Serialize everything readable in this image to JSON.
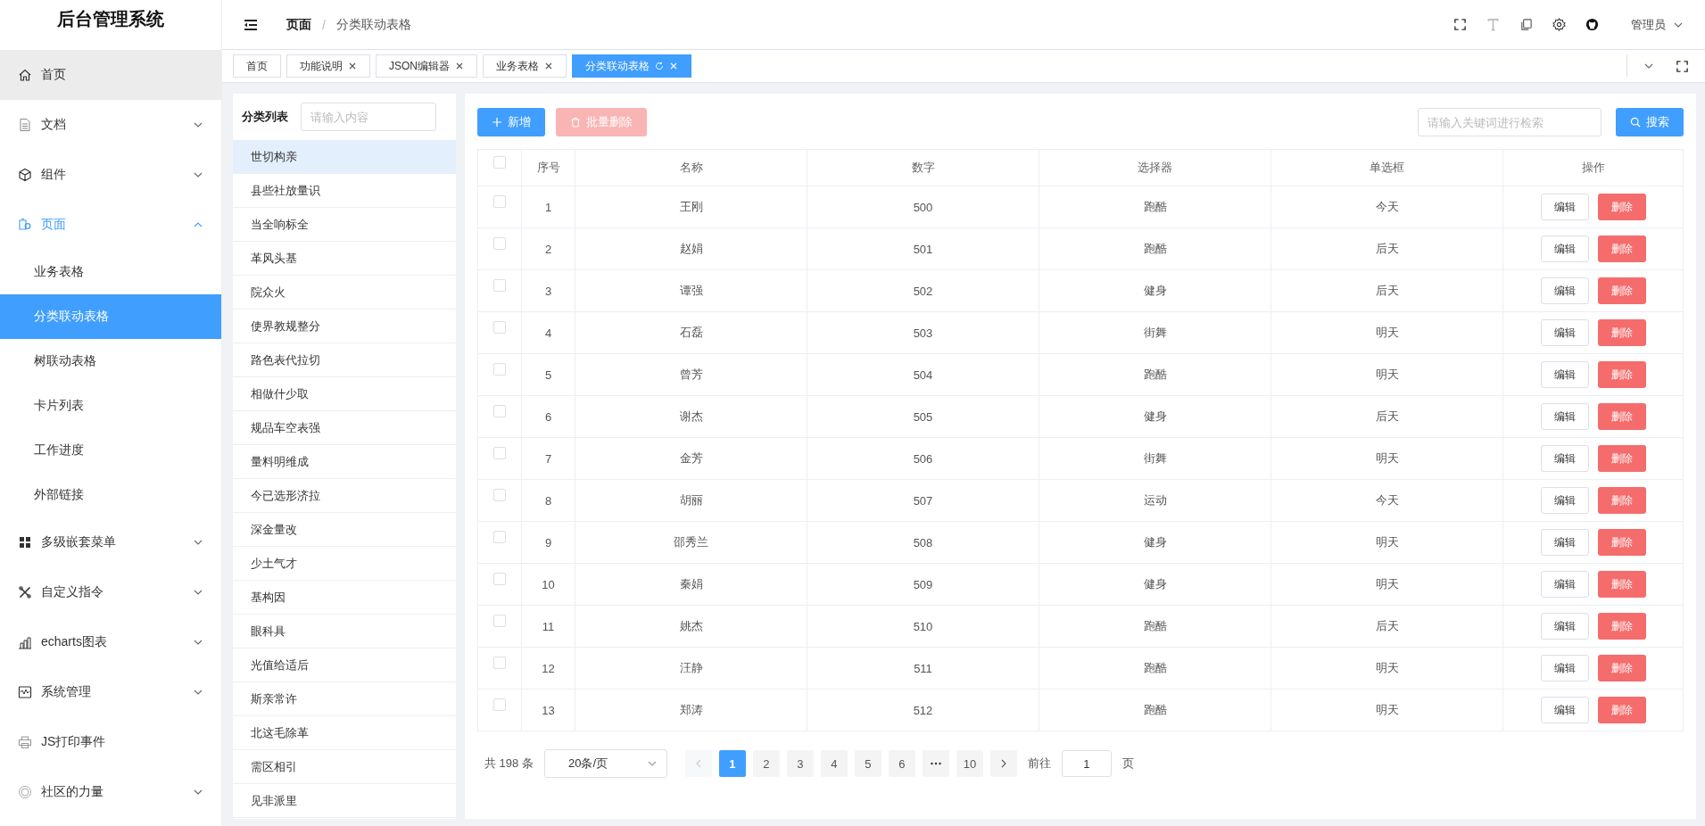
{
  "app_title": "后台管理系统",
  "sidebar": {
    "items": [
      {
        "label": "首页",
        "kind": "link",
        "hovered": true,
        "expanded": false
      },
      {
        "label": "文档",
        "kind": "group",
        "hovered": false,
        "expanded": false
      },
      {
        "label": "组件",
        "kind": "group",
        "hovered": false,
        "expanded": false
      },
      {
        "label": "页面",
        "kind": "group",
        "hovered": false,
        "expanded": true,
        "children": [
          {
            "label": "业务表格",
            "selected": false
          },
          {
            "label": "分类联动表格",
            "selected": true
          },
          {
            "label": "树联动表格",
            "selected": false
          },
          {
            "label": "卡片列表",
            "selected": false
          },
          {
            "label": "工作进度",
            "selected": false
          },
          {
            "label": "外部链接",
            "selected": false
          }
        ]
      },
      {
        "label": "多级嵌套菜单",
        "kind": "group",
        "hovered": false,
        "expanded": false
      },
      {
        "label": "自定义指令",
        "kind": "group",
        "hovered": false,
        "expanded": false
      },
      {
        "label": "echarts图表",
        "kind": "group",
        "hovered": false,
        "expanded": false
      },
      {
        "label": "系统管理",
        "kind": "group",
        "hovered": false,
        "expanded": false
      },
      {
        "label": "JS打印事件",
        "kind": "link",
        "hovered": false,
        "expanded": false
      },
      {
        "label": "社区的力量",
        "kind": "group",
        "hovered": false,
        "expanded": false
      }
    ]
  },
  "breadcrumb": {
    "items": [
      "页面",
      "分类联动表格"
    ],
    "separator": "/"
  },
  "user": {
    "name": "管理员"
  },
  "tabs": [
    {
      "label": "首页",
      "selected": false,
      "closable": false
    },
    {
      "label": "功能说明",
      "selected": false,
      "closable": true
    },
    {
      "label": "JSON编辑器",
      "selected": false,
      "closable": true
    },
    {
      "label": "业务表格",
      "selected": false,
      "closable": true
    },
    {
      "label": "分类联动表格",
      "selected": true,
      "closable": true
    }
  ],
  "category_panel": {
    "title": "分类列表",
    "search": {
      "placeholder": "请输入内容"
    },
    "items": [
      {
        "label": "世切构亲",
        "selected": true
      },
      {
        "label": "县些社放量识",
        "selected": false
      },
      {
        "label": "当全响标全",
        "selected": false
      },
      {
        "label": "革风头基",
        "selected": false
      },
      {
        "label": "院众火",
        "selected": false
      },
      {
        "label": "使界教规整分",
        "selected": false
      },
      {
        "label": "路色表代拉切",
        "selected": false
      },
      {
        "label": "相做什少取",
        "selected": false
      },
      {
        "label": "规品车空表强",
        "selected": false
      },
      {
        "label": "量料明维成",
        "selected": false
      },
      {
        "label": "今已选形济拉",
        "selected": false
      },
      {
        "label": "深金量改",
        "selected": false
      },
      {
        "label": "少土气才",
        "selected": false
      },
      {
        "label": "基构因",
        "selected": false
      },
      {
        "label": "眼科具",
        "selected": false
      },
      {
        "label": "光值给适后",
        "selected": false
      },
      {
        "label": "斯亲常许",
        "selected": false
      },
      {
        "label": "北这毛除革",
        "selected": false
      },
      {
        "label": "需区相引",
        "selected": false
      },
      {
        "label": "见非派里",
        "selected": false
      }
    ]
  },
  "toolbar": {
    "add_button": {
      "label": "新增",
      "disabled": false
    },
    "batch_delete_button": {
      "label": "批量删除",
      "disabled": true
    },
    "search": {
      "placeholder": "请输入关键词进行检索"
    },
    "search_button": {
      "label": "搜索"
    }
  },
  "table": {
    "select_all_checked": false,
    "columns": [
      "序号",
      "名称",
      "数字",
      "选择器",
      "单选框",
      "操作"
    ],
    "rows": [
      {
        "checked": false,
        "cells": [
          "1",
          "王刚",
          "500",
          "跑酷",
          "今天"
        ],
        "actions": [
          "编辑",
          "删除"
        ]
      },
      {
        "checked": false,
        "cells": [
          "2",
          "赵娟",
          "501",
          "跑酷",
          "后天"
        ],
        "actions": [
          "编辑",
          "删除"
        ]
      },
      {
        "checked": false,
        "cells": [
          "3",
          "谭强",
          "502",
          "健身",
          "后天"
        ],
        "actions": [
          "编辑",
          "删除"
        ]
      },
      {
        "checked": false,
        "cells": [
          "4",
          "石磊",
          "503",
          "街舞",
          "明天"
        ],
        "actions": [
          "编辑",
          "删除"
        ]
      },
      {
        "checked": false,
        "cells": [
          "5",
          "曾芳",
          "504",
          "跑酷",
          "明天"
        ],
        "actions": [
          "编辑",
          "删除"
        ]
      },
      {
        "checked": false,
        "cells": [
          "6",
          "谢杰",
          "505",
          "健身",
          "后天"
        ],
        "actions": [
          "编辑",
          "删除"
        ]
      },
      {
        "checked": false,
        "cells": [
          "7",
          "金芳",
          "506",
          "街舞",
          "明天"
        ],
        "actions": [
          "编辑",
          "删除"
        ]
      },
      {
        "checked": false,
        "cells": [
          "8",
          "胡丽",
          "507",
          "运动",
          "今天"
        ],
        "actions": [
          "编辑",
          "删除"
        ]
      },
      {
        "checked": false,
        "cells": [
          "9",
          "邵秀兰",
          "508",
          "健身",
          "明天"
        ],
        "actions": [
          "编辑",
          "删除"
        ]
      },
      {
        "checked": false,
        "cells": [
          "10",
          "秦娟",
          "509",
          "健身",
          "明天"
        ],
        "actions": [
          "编辑",
          "删除"
        ]
      },
      {
        "checked": false,
        "cells": [
          "11",
          "姚杰",
          "510",
          "跑酷",
          "后天"
        ],
        "actions": [
          "编辑",
          "删除"
        ]
      },
      {
        "checked": false,
        "cells": [
          "12",
          "汪静",
          "511",
          "跑酷",
          "明天"
        ],
        "actions": [
          "编辑",
          "删除"
        ]
      },
      {
        "checked": false,
        "cells": [
          "13",
          "郑涛",
          "512",
          "跑酷",
          "明天"
        ],
        "actions": [
          "编辑",
          "删除"
        ]
      }
    ]
  },
  "pagination": {
    "total": "共 198 条",
    "page_size": "20条/页",
    "prev_disabled": true,
    "pages": [
      {
        "kind": "page",
        "label": "1",
        "selected": true
      },
      {
        "kind": "page",
        "label": "2",
        "selected": false
      },
      {
        "kind": "page",
        "label": "3",
        "selected": false
      },
      {
        "kind": "page",
        "label": "4",
        "selected": false
      },
      {
        "kind": "page",
        "label": "5",
        "selected": false
      },
      {
        "kind": "page",
        "label": "6",
        "selected": false
      },
      {
        "kind": "more",
        "selected": false
      },
      {
        "kind": "page",
        "label": "10",
        "selected": false
      }
    ],
    "goto_label": "前往",
    "goto_value": "1",
    "page_unit": "页"
  }
}
